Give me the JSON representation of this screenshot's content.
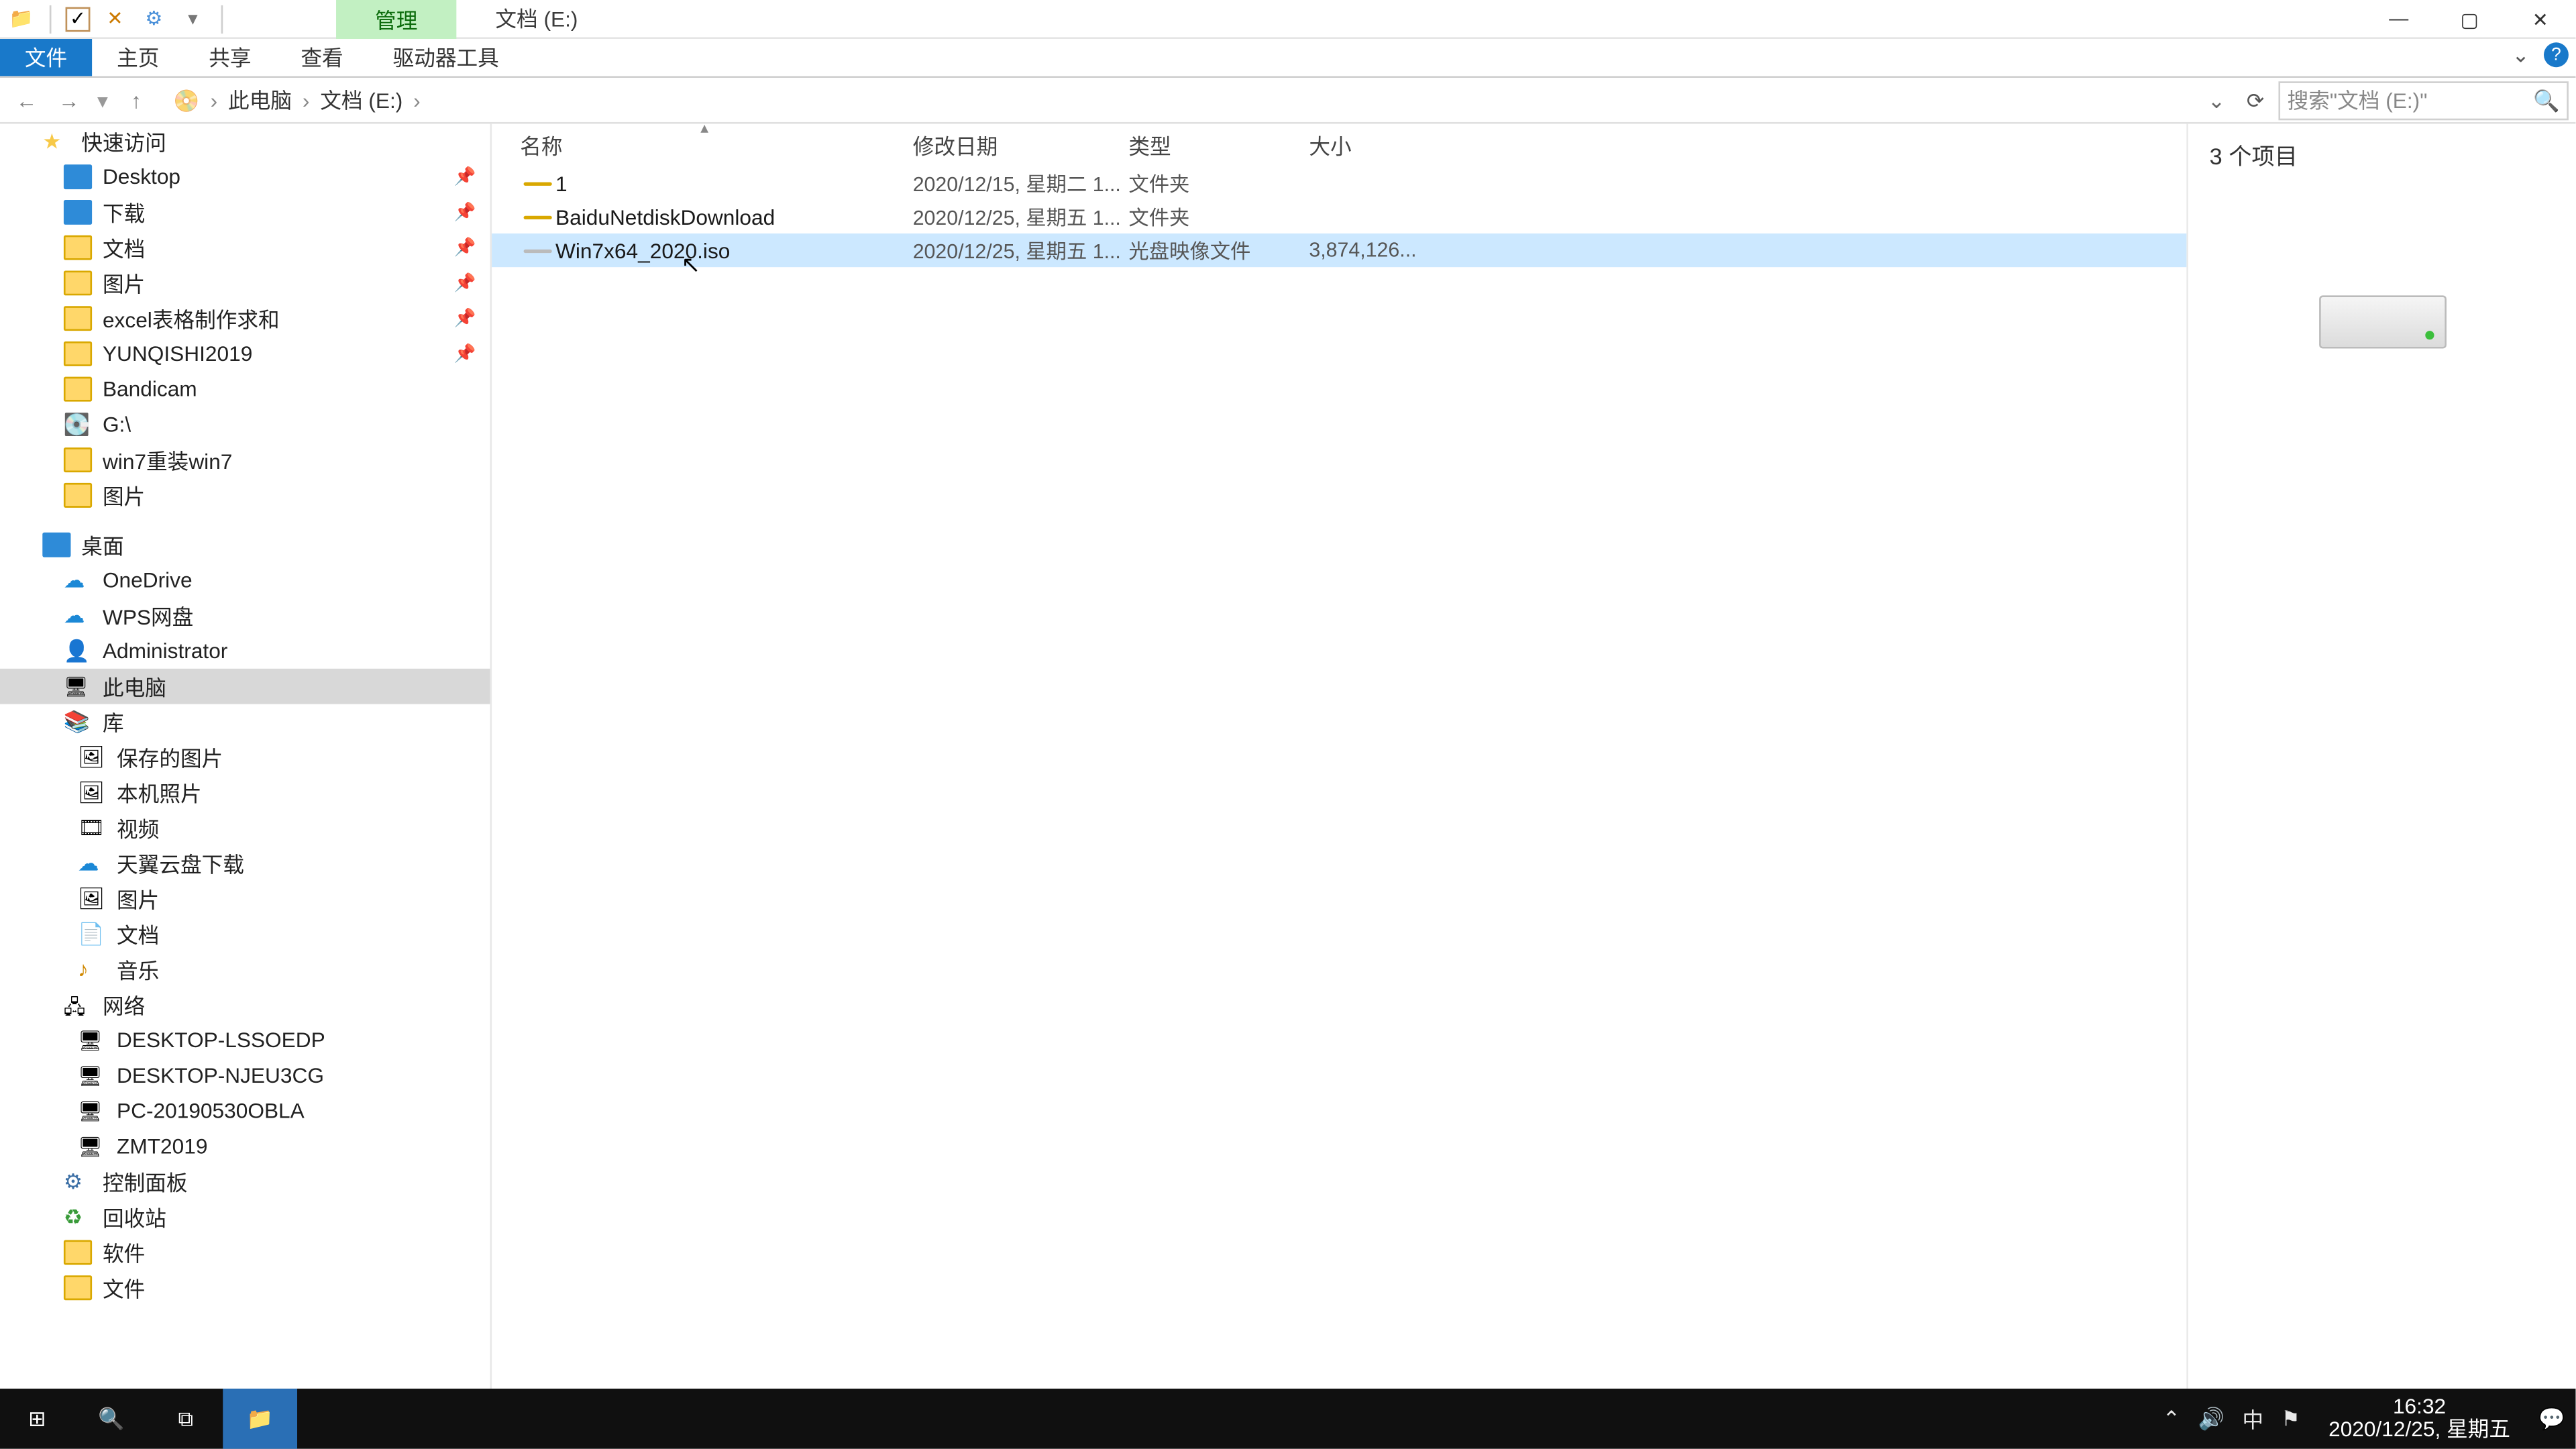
{
  "titlebar": {
    "contextTab": "管理",
    "windowTitle": "文档 (E:)"
  },
  "ribbon": {
    "file": "文件",
    "tabs": [
      "主页",
      "共享",
      "查看",
      "驱动器工具"
    ]
  },
  "breadcrumb": {
    "root": "此电脑",
    "drive": "文档 (E:)"
  },
  "search": {
    "placeholder": "搜索\"文档 (E:)\""
  },
  "columns": {
    "name": "名称",
    "date": "修改日期",
    "type": "类型",
    "size": "大小"
  },
  "rows": [
    {
      "name": "1",
      "date": "2020/12/15, 星期二 1...",
      "type": "文件夹",
      "size": "",
      "icon": "folder"
    },
    {
      "name": "BaiduNetdiskDownload",
      "date": "2020/12/25, 星期五 1...",
      "type": "文件夹",
      "size": "",
      "icon": "folder"
    },
    {
      "name": "Win7x64_2020.iso",
      "date": "2020/12/25, 星期五 1...",
      "type": "光盘映像文件",
      "size": "3,874,126...",
      "icon": "iso",
      "selected": true
    }
  ],
  "preview": {
    "count": "3 个项目"
  },
  "status": {
    "text": "3 个项目"
  },
  "sidebar": {
    "quickAccess": "快速访问",
    "qa": [
      {
        "label": "Desktop",
        "icon": "blue",
        "pin": true
      },
      {
        "label": "下载",
        "icon": "blue",
        "pin": true
      },
      {
        "label": "文档",
        "icon": "folder",
        "pin": true
      },
      {
        "label": "图片",
        "icon": "folder",
        "pin": true
      },
      {
        "label": "excel表格制作求和",
        "icon": "folder",
        "pin": true
      },
      {
        "label": "YUNQISHI2019",
        "icon": "folder",
        "pin": true
      },
      {
        "label": "Bandicam",
        "icon": "folder"
      },
      {
        "label": "G:\\",
        "icon": "drive"
      },
      {
        "label": "win7重装win7",
        "icon": "folder"
      },
      {
        "label": "图片",
        "icon": "folder"
      }
    ],
    "desktop": "桌面",
    "desk": [
      {
        "label": "OneDrive",
        "icon": "cloud"
      },
      {
        "label": "WPS网盘",
        "icon": "cloud"
      },
      {
        "label": "Administrator",
        "icon": "user"
      },
      {
        "label": "此电脑",
        "icon": "computer",
        "selected": true
      },
      {
        "label": "库",
        "icon": "lib"
      }
    ],
    "libs": [
      {
        "label": "保存的图片",
        "icon": "pic"
      },
      {
        "label": "本机照片",
        "icon": "pic"
      },
      {
        "label": "视频",
        "icon": "video"
      },
      {
        "label": "天翼云盘下载",
        "icon": "cloud"
      },
      {
        "label": "图片",
        "icon": "pic"
      },
      {
        "label": "文档",
        "icon": "doc"
      },
      {
        "label": "音乐",
        "icon": "music"
      }
    ],
    "network": "网络",
    "nets": [
      {
        "label": "DESKTOP-LSSOEDP"
      },
      {
        "label": "DESKTOP-NJEU3CG"
      },
      {
        "label": "PC-20190530OBLA"
      },
      {
        "label": "ZMT2019"
      }
    ],
    "controlPanel": "控制面板",
    "recycle": "回收站",
    "soft": "软件",
    "docs": "文件"
  },
  "taskbar": {
    "time": "16:32",
    "date": "2020/12/25, 星期五",
    "ime": "中"
  }
}
